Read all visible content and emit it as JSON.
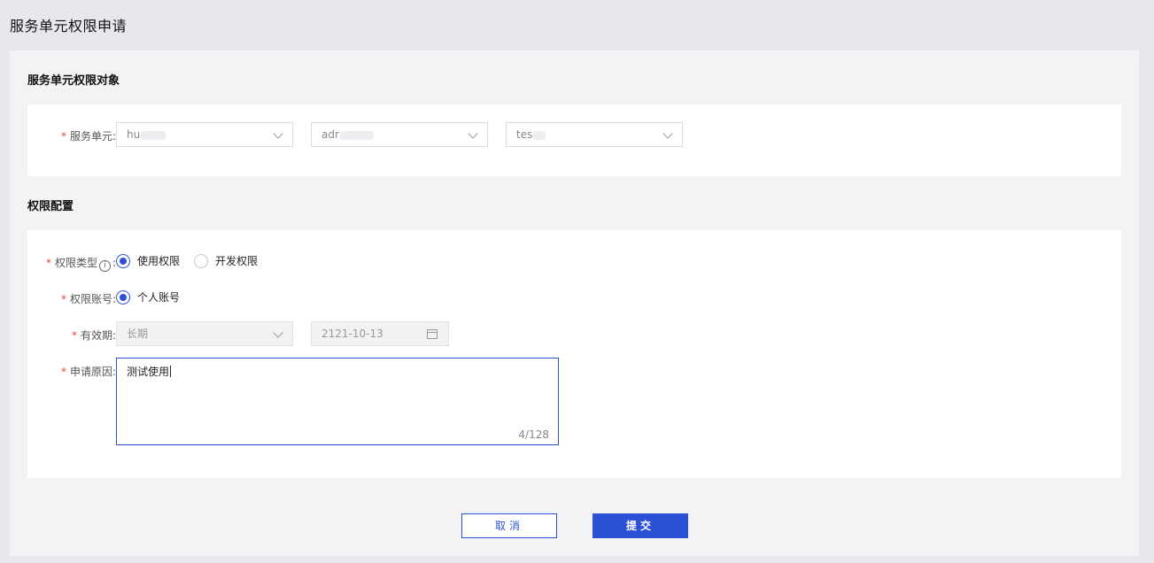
{
  "page": {
    "title": "服务单元权限申请"
  },
  "target_section": {
    "title": "服务单元权限对象",
    "service_unit_label": "服务单元:",
    "selects": [
      {
        "value": "hu"
      },
      {
        "value": "adr"
      },
      {
        "value": "tes"
      }
    ]
  },
  "config_section": {
    "title": "权限配置",
    "perm_type_label": "权限类型",
    "perm_type_colon": ":",
    "perm_type_info_icon": "info-icon",
    "perm_type_options": [
      "使用权限",
      "开发权限"
    ],
    "perm_type_selected": "使用权限",
    "account_label": "权限账号:",
    "account_options": [
      "个人账号"
    ],
    "validity_label": "有效期:",
    "validity_select": "长期",
    "validity_date": "2121-10-13",
    "reason_label": "申请原因:",
    "reason_value": "测试使用",
    "reason_counter": "4/128"
  },
  "footer": {
    "cancel_label": "取消",
    "submit_label": "提交"
  },
  "colors": {
    "accent": "#2d51d6",
    "required": "#e54545"
  }
}
